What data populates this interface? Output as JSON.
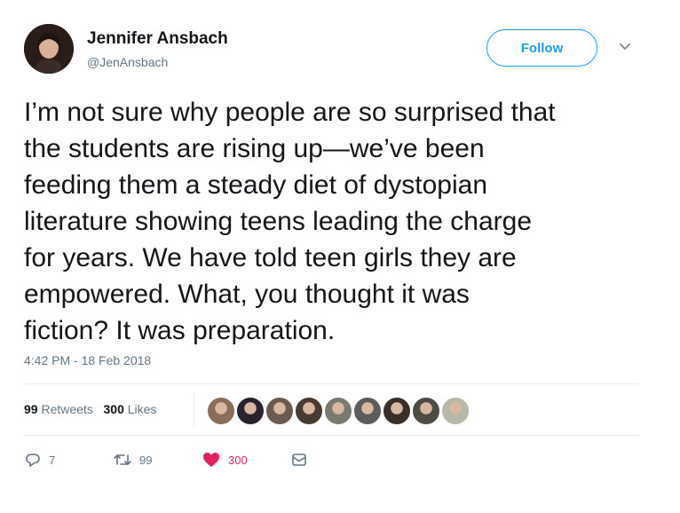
{
  "user": {
    "name": "Jennifer Ansbach",
    "handle": "@JenAnsbach",
    "avatar_icon": "profile-photo"
  },
  "header": {
    "follow_label": "Follow",
    "menu_icon": "chevron-down-icon"
  },
  "tweet": {
    "text": "I’m not sure why people are so surprised that\nthe students are rising up—we’ve been\nfeeding them a steady diet of dystopian\nliterature showing teens leading the charge\nfor years. We have told teen girls they are\nempowered. What, you thought it was\nfiction? It was preparation.",
    "timestamp": "4:42 PM - 18 Feb 2018"
  },
  "stats": {
    "retweets_count": "99",
    "retweets_label": "Retweets",
    "likes_count": "300",
    "likes_label": "Likes"
  },
  "likers": [
    {
      "icon": "liker-avatar",
      "color": "#8a6e5a"
    },
    {
      "icon": "liker-avatar",
      "color": "#2b2230"
    },
    {
      "icon": "liker-avatar",
      "color": "#6a5a50"
    },
    {
      "icon": "liker-avatar",
      "color": "#4a3a34"
    },
    {
      "icon": "liker-avatar",
      "color": "#7a7a70"
    },
    {
      "icon": "liker-avatar",
      "color": "#5c5c5c"
    },
    {
      "icon": "liker-avatar",
      "color": "#3a2e28"
    },
    {
      "icon": "liker-avatar",
      "color": "#4e4a44"
    },
    {
      "icon": "liker-avatar",
      "color": "#b8b8a8"
    }
  ],
  "actions": {
    "reply_count": "7",
    "retweet_count": "99",
    "like_count": "300"
  },
  "colors": {
    "accent": "#1da1f2",
    "like": "#e0245e",
    "muted": "#657786",
    "text": "#14171a"
  }
}
